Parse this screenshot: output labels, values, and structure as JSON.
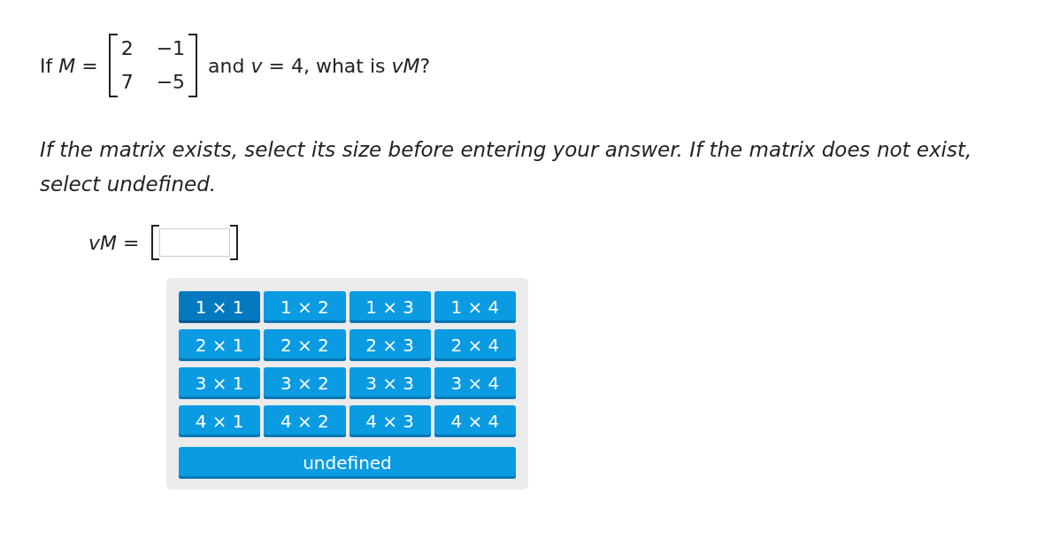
{
  "question": {
    "lead": "If *M* =",
    "matrix": [
      [
        "2",
        "−1"
      ],
      [
        "7",
        "−5"
      ]
    ],
    "tail": "and *v* = 4, what is *vM*?"
  },
  "instruction": "If the matrix exists, select its size before entering your answer. If the matrix does not exist, select undefined.",
  "answer": {
    "label": "*vM* ="
  },
  "size_buttons": [
    [
      {
        "label": "1 × 1",
        "selected": true
      },
      {
        "label": "1 × 2",
        "selected": false
      },
      {
        "label": "1 × 3",
        "selected": false
      },
      {
        "label": "1 × 4",
        "selected": false
      }
    ],
    [
      {
        "label": "2 × 1",
        "selected": false
      },
      {
        "label": "2 × 2",
        "selected": false
      },
      {
        "label": "2 × 3",
        "selected": false
      },
      {
        "label": "2 × 4",
        "selected": false
      }
    ],
    [
      {
        "label": "3 × 1",
        "selected": false
      },
      {
        "label": "3 × 2",
        "selected": false
      },
      {
        "label": "3 × 3",
        "selected": false
      },
      {
        "label": "3 × 4",
        "selected": false
      }
    ],
    [
      {
        "label": "4 × 1",
        "selected": false
      },
      {
        "label": "4 × 2",
        "selected": false
      },
      {
        "label": "4 × 3",
        "selected": false
      },
      {
        "label": "4 × 4",
        "selected": false
      }
    ]
  ],
  "undefined_button": {
    "label": "undefined",
    "selected": false
  }
}
